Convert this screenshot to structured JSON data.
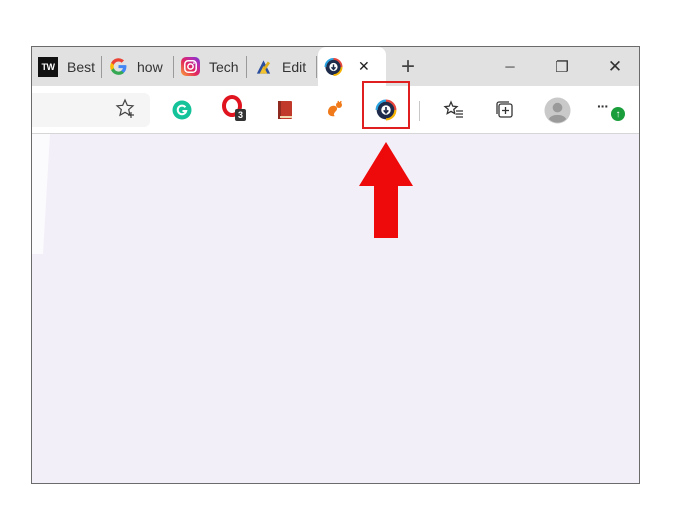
{
  "tabs": [
    {
      "label": "Best",
      "icon": "tw-icon"
    },
    {
      "label": "how",
      "icon": "google-icon"
    },
    {
      "label": "Tech",
      "icon": "instagram-icon"
    },
    {
      "label": "Edit",
      "icon": "edit-icon"
    },
    {
      "label": "",
      "icon": "downloader-icon",
      "active": true
    }
  ],
  "window_controls": {
    "new_tab": "+",
    "minimize": "─",
    "restore": "❐",
    "close": "✕"
  },
  "extensions": {
    "opera_badge": "3",
    "more_menu": "···",
    "update_badge": "↑"
  },
  "logo_text": "TW",
  "colors": {
    "highlight": "#e02020",
    "arrow": "#ee0a0a",
    "content_bg": "#f3eff8",
    "grammarly": "#15c39a",
    "update_green": "#1a9e3c"
  }
}
